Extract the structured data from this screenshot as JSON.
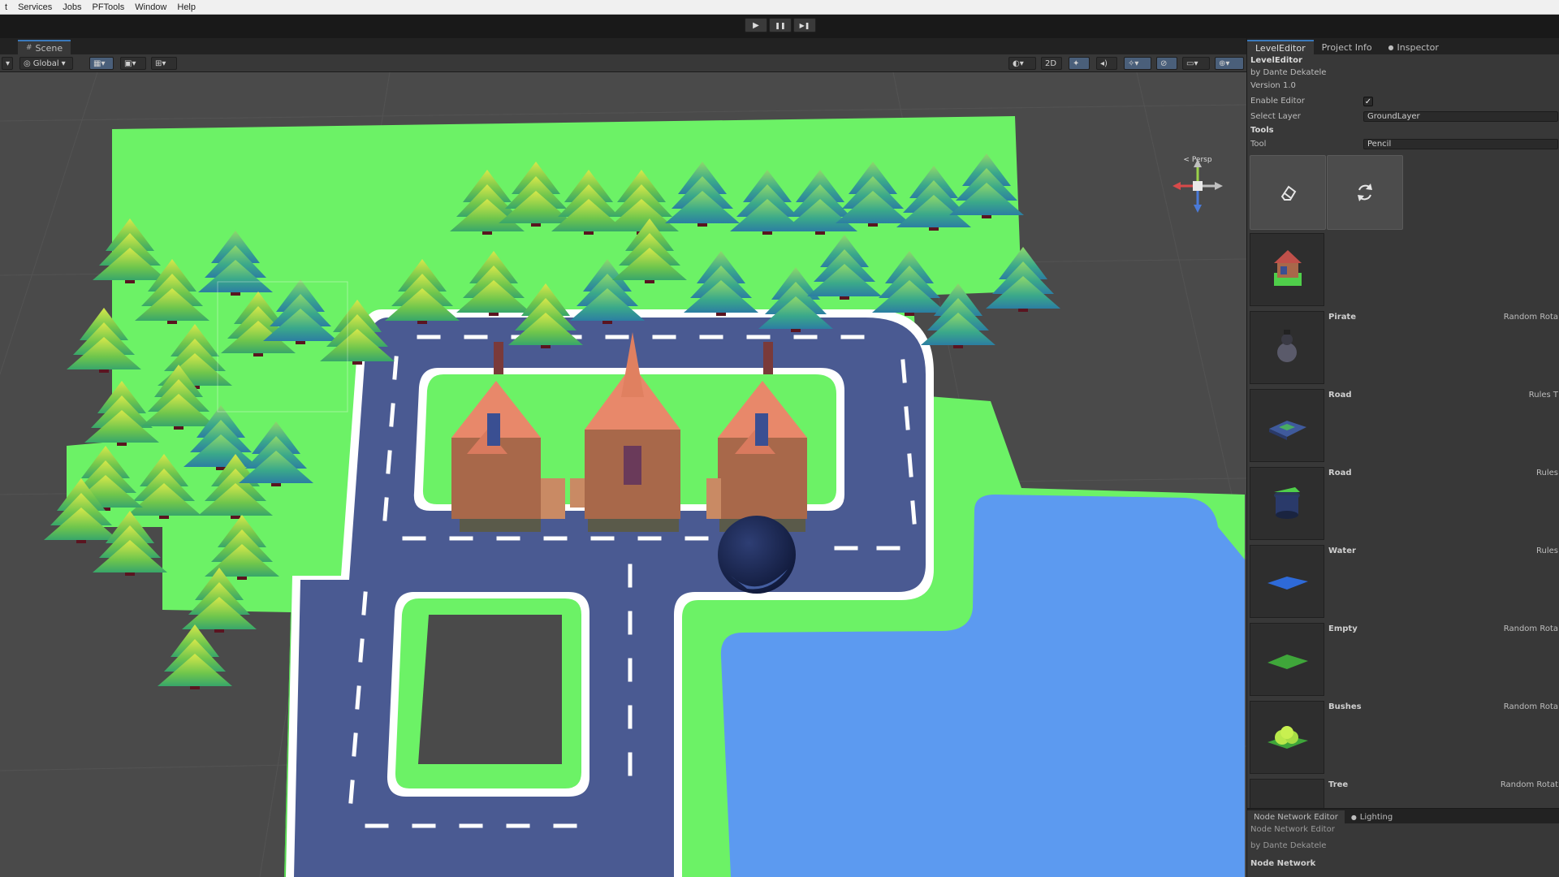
{
  "menubar": {
    "items": [
      "Services",
      "Jobs",
      "PFTools",
      "Window",
      "Help"
    ],
    "edge_glyph": "t"
  },
  "playback": {
    "play_icon": "play-icon",
    "pause_icon": "pause-icon",
    "step_icon": "step-icon",
    "play_glyph": "▶",
    "pause_glyph": "❚❚",
    "step_glyph": "▶❚"
  },
  "scene_tab": {
    "label": "Scene",
    "icon_glyph": "#"
  },
  "scene_toolbar": {
    "pivot_label": "Global"
  },
  "gizmo": {
    "persp_label": "< Persp"
  },
  "inspector": {
    "tabs": [
      {
        "label": "LevelEditor"
      },
      {
        "label": "Project Info"
      },
      {
        "label": "Inspector",
        "icon_glyph": "●"
      }
    ],
    "title": "LevelEditor",
    "author": "by Dante Dekatele",
    "version": "Version 1.0",
    "enable_editor_label": "Enable Editor",
    "enable_editor_checked": true,
    "enable_editor_mark": "✓",
    "select_layer_label": "Select Layer",
    "select_layer_value": "GroundLayer",
    "tools_header": "Tools",
    "tool_label": "Tool",
    "tool_value": "Pencil",
    "tool_buttons": [
      {
        "icon": "eraser-icon"
      },
      {
        "icon": "rotate-icon"
      }
    ],
    "assets": [
      {
        "name": "",
        "option": "",
        "thumb": "house"
      },
      {
        "name": "Pirate",
        "option": "Random Rota",
        "thumb": "pirate"
      },
      {
        "name": "Road",
        "option": "Rules T",
        "thumb": "road-flat"
      },
      {
        "name": "Road",
        "option": "Rules",
        "thumb": "road-bin"
      },
      {
        "name": "Water",
        "option": "Rules",
        "thumb": "water"
      },
      {
        "name": "Empty",
        "option": "Random Rota",
        "thumb": "grass"
      },
      {
        "name": "Bushes",
        "option": "Random Rota",
        "thumb": "bush"
      },
      {
        "name": "Tree",
        "option": "Random Rotat",
        "thumb": "tree"
      }
    ]
  },
  "bottom_panel": {
    "tabs": [
      {
        "label": "Node Network Editor"
      },
      {
        "label": "Lighting",
        "icon_glyph": "●"
      }
    ],
    "title": "Node Network Editor",
    "author": "by Dante Dekatele",
    "section": "Node Network"
  },
  "colors": {
    "grass": "#6cf266",
    "grass_dark": "#4fcf4a",
    "road": "#4a5a92",
    "water": "#5c9af0",
    "roof": "#e8886a",
    "trunk": "#5a1420",
    "ball": "#1c2a55",
    "accent": "#3a79bb"
  }
}
